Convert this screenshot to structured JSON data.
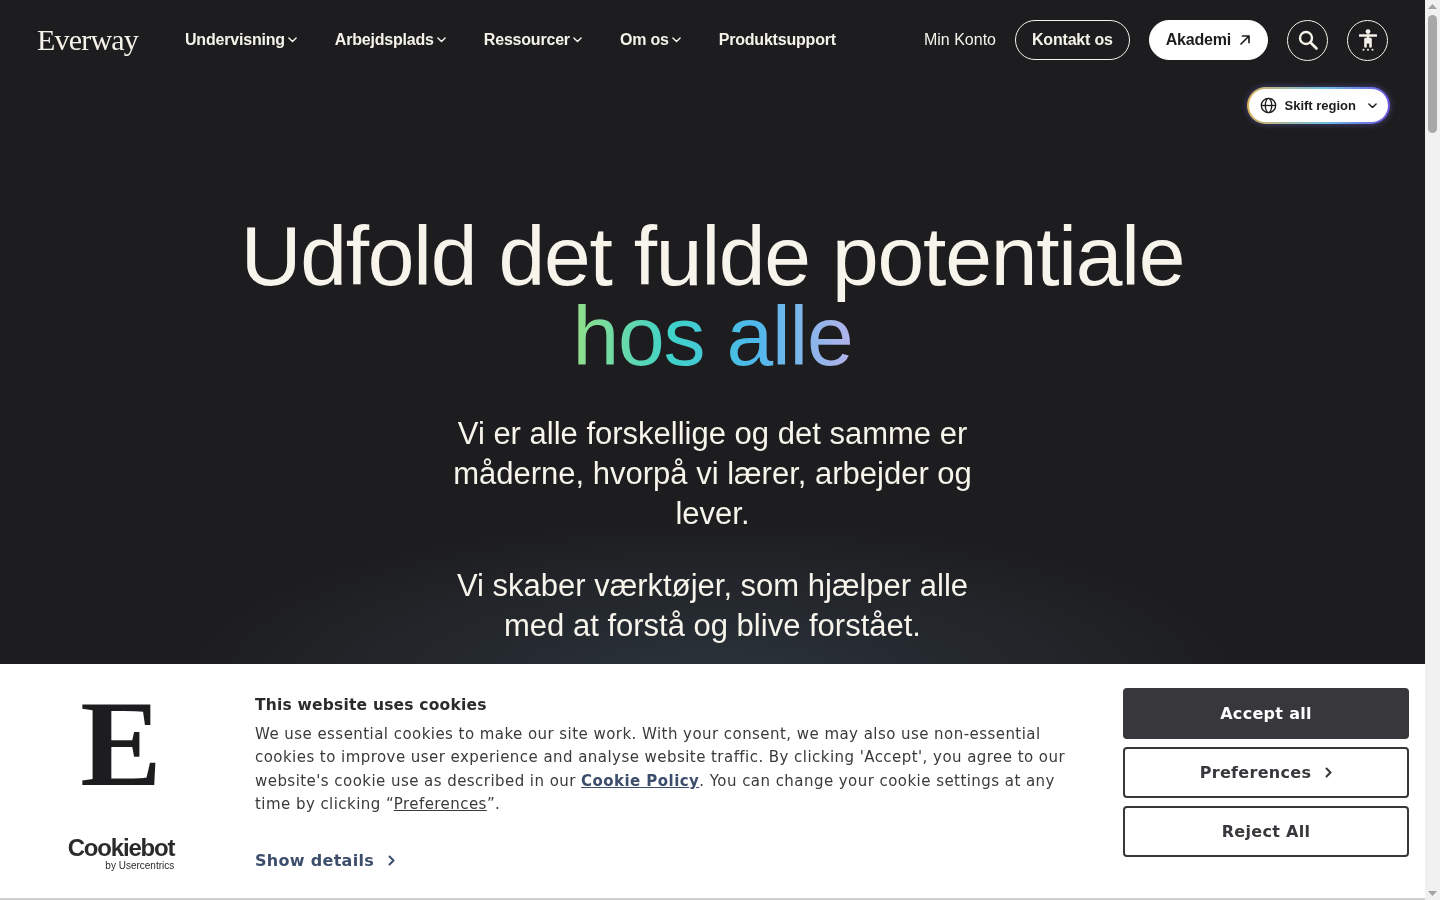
{
  "header": {
    "logo": "Everway",
    "nav": [
      {
        "kind": "menu",
        "label": "Undervisning"
      },
      {
        "kind": "menu",
        "label": "Arbejdsplads"
      },
      {
        "kind": "menu",
        "label": "Ressourcer"
      },
      {
        "kind": "menu",
        "label": "Om os"
      },
      {
        "kind": "link",
        "label": "Produktsupport"
      }
    ],
    "actions": [
      {
        "kind": "text_link",
        "label": "Min Konto"
      },
      {
        "kind": "outline",
        "label": "Kontakt os"
      },
      {
        "kind": "external",
        "label": "Akademi"
      },
      {
        "kind": "search"
      },
      {
        "kind": "accessibility"
      }
    ]
  },
  "region_button": {
    "label": "Skift region"
  },
  "hero": {
    "heading": "Udfold det fulde potentiale",
    "highlight": "hos alle",
    "paragraphs": [
      "Vi er alle forskellige og det samme er måderne, hvorpå vi lærer, arbejder og lever.",
      "Vi skaber værktøjer, som hjælper alle med at forstå og blive forstået."
    ]
  },
  "cookie_banner": {
    "logo_mark": "E",
    "provider": "Cookiebot",
    "provider_byline": "by Usercentrics",
    "title": "This website uses cookies",
    "body": [
      {
        "kind": "text",
        "text": "We use essential cookies to make our site work. With your consent, we may also use non-essential cookies to improve user experience and analyse website traffic. By clicking 'Accept', you agree to our website's cookie use as described in our "
      },
      {
        "kind": "strong_link",
        "text": "Cookie Policy"
      },
      {
        "kind": "text",
        "text": ". You can change your cookie settings at any time by clicking “"
      },
      {
        "kind": "link",
        "text": "Preferences"
      },
      {
        "kind": "text",
        "text": "”."
      }
    ],
    "details_link": "Show details",
    "buttons": [
      {
        "kind": "filled",
        "label": "Accept all"
      },
      {
        "kind": "outline_more",
        "label": "Preferences"
      },
      {
        "kind": "outline",
        "label": "Reject All"
      }
    ]
  }
}
